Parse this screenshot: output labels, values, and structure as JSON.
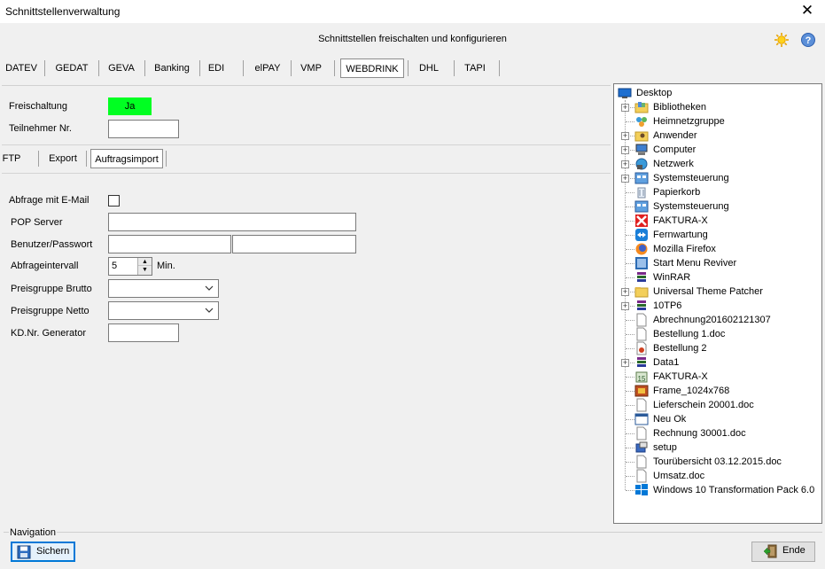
{
  "window": {
    "title": "Schnittstellenverwaltung",
    "close": "✕"
  },
  "header": {
    "subtitle": "Schnittstellen freischalten und konfigurieren"
  },
  "main_tabs": [
    "DATEV",
    "GEDAT",
    "GEVA",
    "Banking",
    "EDI",
    "elPAY",
    "VMP",
    "WEBDRINK",
    "DHL",
    "TAPI"
  ],
  "active_main_tab": "WEBDRINK",
  "freischaltung": {
    "label": "Freischaltung",
    "value": "Ja",
    "color": "#00ff22"
  },
  "teilnehmer": {
    "label": "Teilnehmer Nr.",
    "value": ""
  },
  "sub_tabs": [
    "FTP",
    "Export",
    "Auftragsimport"
  ],
  "active_sub_tab": "Auftragsimport",
  "form": {
    "email": {
      "label": "Abfrage mit E-Mail",
      "checked": false
    },
    "pop": {
      "label": "POP Server",
      "value": ""
    },
    "user": {
      "label": "Benutzer/Passwort",
      "user": "",
      "password": ""
    },
    "interval": {
      "label": "Abfrageintervall",
      "value": "5",
      "unit": "Min."
    },
    "brutto": {
      "label": "Preisgruppe Brutto",
      "value": ""
    },
    "netto": {
      "label": "Preisgruppe Netto",
      "value": ""
    },
    "kdnr": {
      "label": "KD.Nr. Generator",
      "value": ""
    }
  },
  "tree": {
    "root": "Desktop",
    "items": [
      {
        "label": "Bibliotheken",
        "icon": "folder-library-icon",
        "expandable": true
      },
      {
        "label": "Heimnetzgruppe",
        "icon": "homegroup-icon",
        "expandable": false
      },
      {
        "label": "Anwender",
        "icon": "user-folder-icon",
        "expandable": true
      },
      {
        "label": "Computer",
        "icon": "computer-icon",
        "expandable": true
      },
      {
        "label": "Netzwerk",
        "icon": "network-icon",
        "expandable": true
      },
      {
        "label": "Systemsteuerung",
        "icon": "control-panel-icon",
        "expandable": true
      },
      {
        "label": "Papierkorb",
        "icon": "recycle-bin-icon",
        "expandable": false
      },
      {
        "label": "Systemsteuerung",
        "icon": "control-panel-icon",
        "expandable": false
      },
      {
        "label": "FAKTURA-X",
        "icon": "faktura-red-icon",
        "expandable": false
      },
      {
        "label": "Fernwartung",
        "icon": "teamviewer-icon",
        "expandable": false
      },
      {
        "label": "Mozilla Firefox",
        "icon": "firefox-icon",
        "expandable": false
      },
      {
        "label": "Start Menu Reviver",
        "icon": "start-menu-reviver-icon",
        "expandable": false
      },
      {
        "label": "WinRAR",
        "icon": "winrar-icon",
        "expandable": false
      },
      {
        "label": "Universal Theme Patcher",
        "icon": "folder-icon",
        "expandable": true
      },
      {
        "label": "10TP6",
        "icon": "winrar-icon",
        "expandable": true
      },
      {
        "label": "Abrechnung201602121307",
        "icon": "document-icon",
        "expandable": false
      },
      {
        "label": "Bestellung 1.doc",
        "icon": "document-icon",
        "expandable": false
      },
      {
        "label": "Bestellung 2",
        "icon": "image-doc-icon",
        "expandable": false
      },
      {
        "label": "Data1",
        "icon": "winrar-icon",
        "expandable": true
      },
      {
        "label": "FAKTURA-X",
        "icon": "faktura-15-icon",
        "expandable": false
      },
      {
        "label": "Frame_1024x768",
        "icon": "frame-image-icon",
        "expandable": false
      },
      {
        "label": "Lieferschein 20001.doc",
        "icon": "document-icon",
        "expandable": false
      },
      {
        "label": "Neu Ok",
        "icon": "window-icon",
        "expandable": false
      },
      {
        "label": "Rechnung 30001.doc",
        "icon": "document-icon",
        "expandable": false
      },
      {
        "label": "setup",
        "icon": "setup-icon",
        "expandable": false
      },
      {
        "label": "Tourübersicht 03.12.2015.doc",
        "icon": "document-icon",
        "expandable": false
      },
      {
        "label": "Umsatz.doc",
        "icon": "document-icon",
        "expandable": false
      },
      {
        "label": "Windows 10 Transformation Pack 6.0",
        "icon": "windows-icon",
        "expandable": false
      }
    ]
  },
  "navigation": {
    "label": "Navigation",
    "save": "Sichern",
    "end": "Ende"
  }
}
